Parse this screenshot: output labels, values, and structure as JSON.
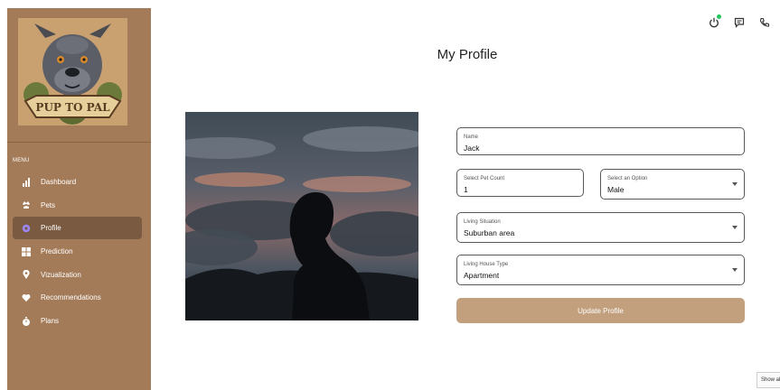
{
  "sidebar": {
    "logo_text": "PUP TO PAL",
    "menu_heading": "MENU",
    "items": [
      {
        "label": "Dashboard",
        "icon": "bar-chart-icon",
        "active": false
      },
      {
        "label": "Pets",
        "icon": "dog-icon",
        "active": false
      },
      {
        "label": "Profile",
        "icon": "user-settings-icon",
        "active": true
      },
      {
        "label": "Prediction",
        "icon": "grid-icon",
        "active": false
      },
      {
        "label": "Vizualization",
        "icon": "map-pin-icon",
        "active": false
      },
      {
        "label": "Recommendations",
        "icon": "heart-icon",
        "active": false
      },
      {
        "label": "Plans",
        "icon": "stopwatch-icon",
        "active": false
      }
    ],
    "active_color": "#7a5a40",
    "background_color": "#a47b58"
  },
  "topbar": {
    "icons": [
      "power-icon",
      "message-icon",
      "phone-icon"
    ],
    "status_color": "#22c55e"
  },
  "main": {
    "title": "My Profile",
    "form": {
      "name": {
        "label": "Name",
        "value": "Jack"
      },
      "pet_count": {
        "label": "Select Pet Count",
        "value": "1"
      },
      "gender": {
        "label": "Select an Option",
        "value": "Male"
      },
      "living_situation": {
        "label": "Living Situation",
        "value": "Suburban area"
      },
      "house_type": {
        "label": "Living House Type",
        "value": "Apartment"
      },
      "submit_label": "Update Profile"
    }
  },
  "footer": {
    "show_tab_label": "Show all"
  },
  "accent_color": "#c2a07e"
}
